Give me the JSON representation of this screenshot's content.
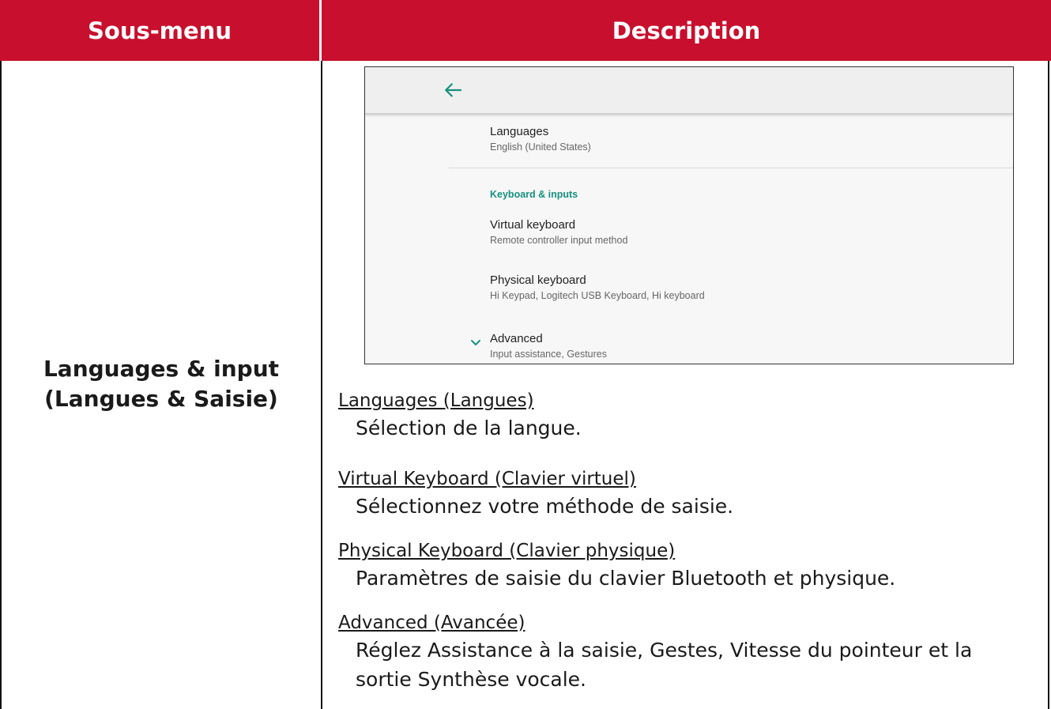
{
  "table": {
    "header_left": "Sous-menu",
    "header_right": "Description",
    "submenu_line1": "Languages & input",
    "submenu_line2": "(Langues & Saisie)"
  },
  "screenshot": {
    "items": [
      {
        "title": "Languages",
        "subtitle": "English (United States)"
      },
      {
        "title": "Virtual keyboard",
        "subtitle": "Remote controller input method"
      },
      {
        "title": "Physical keyboard",
        "subtitle": "Hi Keypad, Logitech USB Keyboard, Hi keyboard"
      },
      {
        "title": "Advanced",
        "subtitle": "Input assistance, Gestures"
      }
    ],
    "section_label": "Keyboard & inputs",
    "accent_color": "#17907f"
  },
  "descriptions": [
    {
      "heading": "Languages (Langues)",
      "body": "Sélection de la langue."
    },
    {
      "heading": "Virtual Keyboard (Clavier virtuel)",
      "body": "Sélectionnez votre méthode de saisie."
    },
    {
      "heading": "Physical Keyboard (Clavier physique)",
      "body": "Paramètres de saisie du clavier Bluetooth et physique."
    },
    {
      "heading": "Advanced (Avancée)",
      "body_line1": "Réglez Assistance à la saisie, Gestes, Vitesse du pointeur et la",
      "body_line2": "sortie Synthèse vocale."
    }
  ],
  "colors": {
    "header_bg": "#c8102e"
  }
}
